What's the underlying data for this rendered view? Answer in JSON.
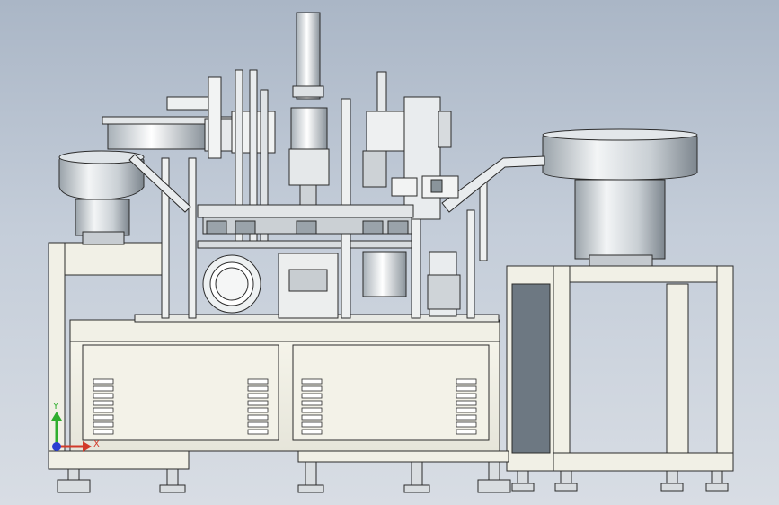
{
  "triad": {
    "y_label": "Y",
    "x_label": "X",
    "y_color": "#2fae2f",
    "x_color": "#d23a2a",
    "z_color": "#2a3fd2"
  },
  "colors": {
    "frame": "#f1f0e6",
    "frame_edge": "#2b2b2b",
    "metal_light": "#e9eef2",
    "metal_dark": "#8b96a0",
    "background_top": "#aab6c6",
    "background_bottom": "#d8dde4"
  },
  "components": [
    "vibratory-bowl-feeder-left",
    "vibratory-bowl-feeder-right",
    "main-cabinet-base",
    "side-feeder-stand",
    "central-pneumatic-cylinder",
    "rotary-index-table",
    "linear-feed-track"
  ]
}
